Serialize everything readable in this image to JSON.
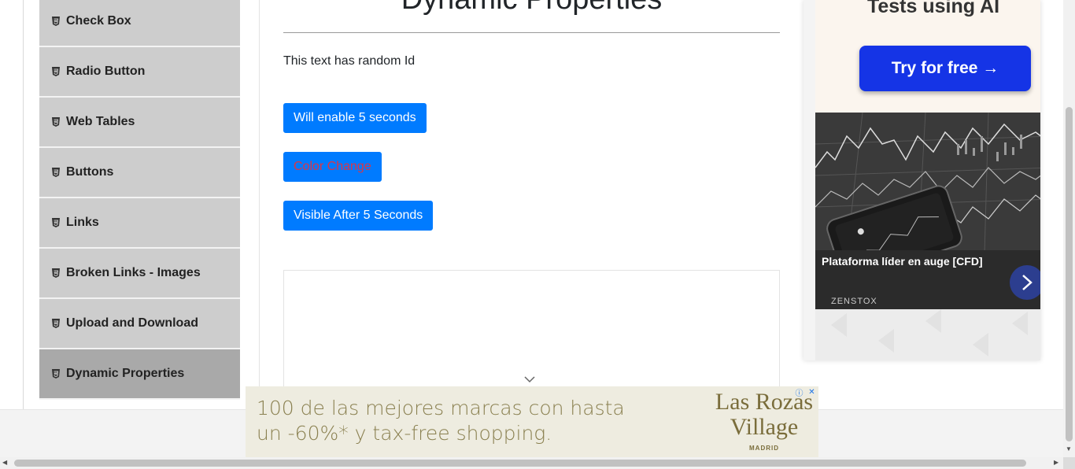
{
  "sidebar": {
    "items": [
      {
        "label": "Check Box",
        "active": false
      },
      {
        "label": "Radio Button",
        "active": false
      },
      {
        "label": "Web Tables",
        "active": false
      },
      {
        "label": "Buttons",
        "active": false
      },
      {
        "label": "Links",
        "active": false
      },
      {
        "label": "Broken Links - Images",
        "active": false
      },
      {
        "label": "Upload and Download",
        "active": false
      },
      {
        "label": "Dynamic Properties",
        "active": true
      }
    ],
    "icon": "html5-icon"
  },
  "main": {
    "title": "Dynamic Properties",
    "random_text": "This text has random Id",
    "buttons": {
      "enable_after": "Will enable 5 seconds",
      "color_change": "Color Change",
      "visible_after": "Visible After 5 Seconds"
    },
    "color_change_text_color": "#dc3545"
  },
  "right_ad": {
    "headline": "Tests using AI",
    "cta": "Try for free →",
    "caption": "Plataforma líder en auge [CFD]",
    "brand": "ZENSTOX",
    "next_icon": "chevron-right-icon"
  },
  "banner_ad": {
    "line1": "100 de las mejores marcas con hasta",
    "line2": "un -60%* y tax-free shopping.",
    "logo_line1": "Las Rozas",
    "logo_line2": "Village",
    "logo_sub": "MADRID",
    "info_icon": "info-icon",
    "close_icon": "close-icon"
  },
  "colors": {
    "primary": "#007bff",
    "sidebar_bg": "#cdcdcd",
    "sidebar_active": "#a9a9a9"
  }
}
